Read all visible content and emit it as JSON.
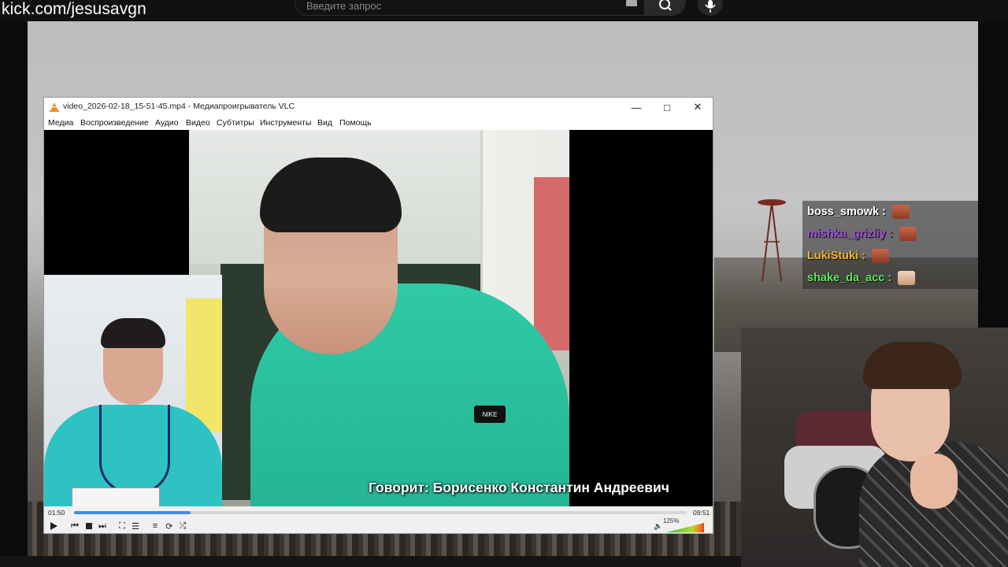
{
  "stream": {
    "url": "kick.com/jesusavgn",
    "search_placeholder": "Введите запрос"
  },
  "vlc": {
    "title": "video_2026-02-18_15-51-45.mp4 - Медиапроигрыватель VLC",
    "menu": [
      "Медиа",
      "Воспроизведение",
      "Аудио",
      "Видео",
      "Субтитры",
      "Инструменты",
      "Вид",
      "Помощь"
    ],
    "subtitle": "Говорит: Борисенко Константин Андреевич",
    "time_current": "01:50",
    "time_total": "09:51",
    "progress": 0.19,
    "volume": "125%",
    "brand_logo_text": "NIKE"
  },
  "chat": {
    "messages": [
      {
        "user": "boss_smowk",
        "color": "#ffffff",
        "emote": "face-emote"
      },
      {
        "user": "mishka_grizliy",
        "color": "#9d4ed8",
        "emote": "face-emote"
      },
      {
        "user": "LukiStuki",
        "color": "#f0b429",
        "emote": "face-emote"
      },
      {
        "user": "shake_da_acc",
        "color": "#5ee65a",
        "emote": "face-emote"
      }
    ]
  }
}
